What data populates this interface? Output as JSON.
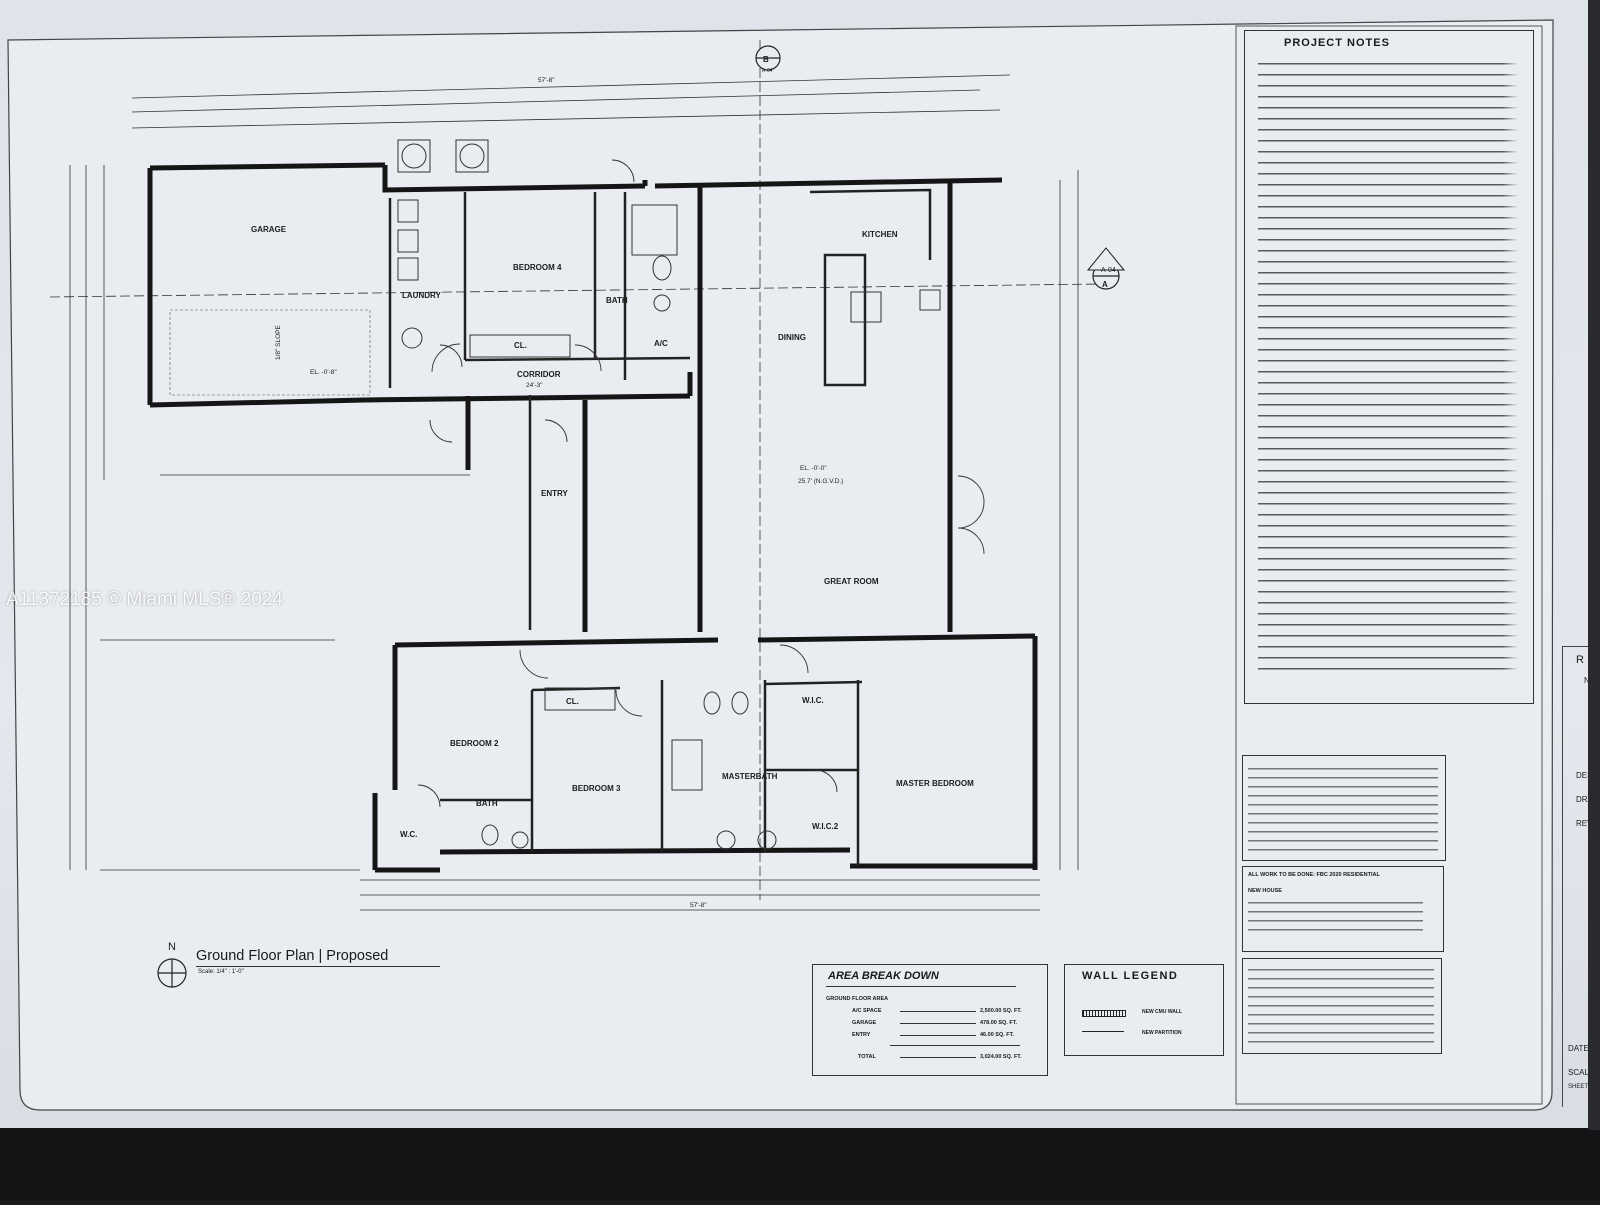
{
  "watermark": "A11372185 © Miami MLS® 2024",
  "title_block": {
    "plan_title": "Ground Floor Plan | Proposed",
    "scale": "Scale: 1/4\" : 1'-0\"",
    "north": "N"
  },
  "rooms": {
    "garage": "GARAGE",
    "laundry": "LAUNDRY",
    "bedroom4": "BEDROOM 4",
    "bath_upper": "BATH",
    "closet_upper": "CL.",
    "corridor": "CORRIDOR",
    "kitchen": "KITCHEN",
    "dining": "DINING",
    "entry": "ENTRY",
    "great_room": "GREAT ROOM",
    "bedroom2": "BEDROOM 2",
    "closet_b3": "CL.",
    "bedroom3": "BEDROOM 3",
    "bath_lower": "BATH",
    "wc": "W.C.",
    "masterbath": "MASTERBATH",
    "wic1": "W.I.C.",
    "wic2": "W.I.C.2",
    "master_bedroom": "MASTER BEDROOM",
    "ac": "A/C"
  },
  "annotations": {
    "elevation_great_room": "EL. -0'-0\"",
    "elevation_great_room_2": "25.7' (N.G.V.D.)",
    "elevation_garage": "EL. -0'-8\"",
    "slope": "1/8\" SLOPE",
    "section_a": "A",
    "section_a_ref": "A-04",
    "section_b": "B",
    "section_b_ref": "A-04",
    "dim_overall_top": "57'-8\"",
    "dim_overall_bottom": "57'-8\"",
    "dim_corridor": "24'-3\""
  },
  "project_notes": {
    "heading": "PROJECT NOTES"
  },
  "area_breakdown": {
    "heading": "AREA BREAK DOWN",
    "rows": [
      {
        "label": "A/C SPACE",
        "value": "2,500.00 SQ. FT."
      },
      {
        "label": "GARAGE",
        "value": "478.00 SQ. FT."
      },
      {
        "label": "ENTRY",
        "value": "46.00 SQ. FT."
      },
      {
        "label": "TOTAL",
        "value": "3,024.00 SQ. FT."
      }
    ],
    "subheading": "GROUND FLOOR AREA"
  },
  "wall_legend": {
    "heading": "WALL LEGEND",
    "rows": [
      {
        "label": "NEW CMU WALL"
      },
      {
        "label": "NEW PARTITION"
      }
    ]
  },
  "code_box": {
    "line1": "ALL WORK TO BE DONE: FBC 2020 RESIDENTIAL",
    "line2": "NEW HOUSE"
  },
  "side_tabs": [
    "No.",
    "DESIGN",
    "DRAWN",
    "REVIS",
    "DATE:",
    "SCALE:",
    "SHEET"
  ]
}
